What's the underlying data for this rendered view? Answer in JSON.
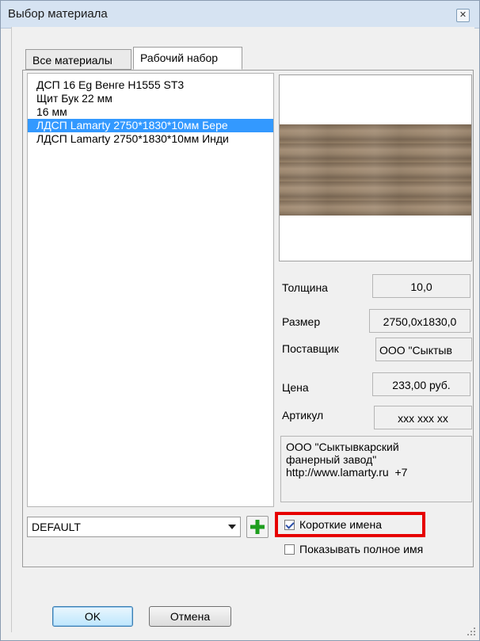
{
  "window": {
    "title": "Выбор материала"
  },
  "tabs": [
    {
      "label": "Все материалы",
      "active": false
    },
    {
      "label": "Рабочий набор",
      "active": true
    }
  ],
  "materials": [
    {
      "label": "ДСП 16 Eg Венге H1555 ST3",
      "selected": false
    },
    {
      "label": "Щит Бук 22 мм",
      "selected": false
    },
    {
      "label": "16 мм",
      "selected": false
    },
    {
      "label": "ЛДСП Lamarty 2750*1830*10мм Бере",
      "selected": true
    },
    {
      "label": "ЛДСП Lamarty 2750*1830*10мм Инди",
      "selected": false
    }
  ],
  "properties": {
    "thickness": {
      "label": "Толщина",
      "value": "10,0"
    },
    "size": {
      "label": "Размер",
      "value": "2750,0x1830,0"
    },
    "supplier": {
      "label": "Поставщик",
      "value": "ООО \"Сыктыв"
    },
    "price": {
      "label": "Цена",
      "value": "233,00 руб."
    },
    "article": {
      "label": "Артикул",
      "value": "xxx xxx xx"
    }
  },
  "supplier_info": "ООО \"Сыктывкарский\nфанерный завод\"\nhttp://www.lamarty.ru  +7",
  "set_selector": {
    "value": "DEFAULT"
  },
  "options": {
    "short_names": {
      "label": "Короткие имена",
      "checked": true
    },
    "show_full_name": {
      "label": "Показывать полное имя",
      "checked": false
    }
  },
  "buttons": {
    "ok": "OK",
    "cancel": "Отмена"
  },
  "colors": {
    "selection": "#3399ff",
    "highlight": "#e60000",
    "add_icon": "#1e9e1e"
  }
}
